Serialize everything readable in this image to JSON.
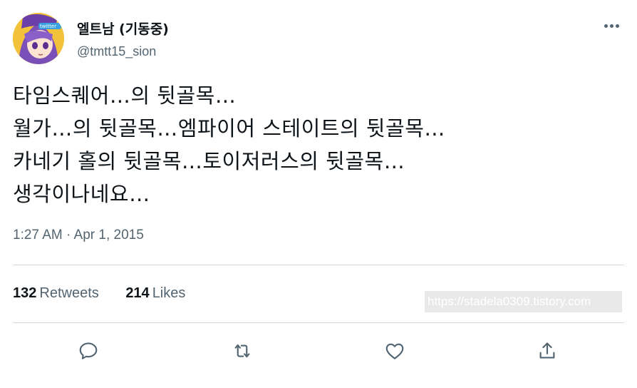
{
  "user": {
    "display_name": "엘트남 (기동중)",
    "handle": "@tmtt15_sion",
    "avatar_icon": "avatar-anime-character-icon",
    "avatar_badge_text": "twitter"
  },
  "tweet": {
    "lines": [
      "타임스퀘어…의 뒷골목…",
      "월가…의 뒷골목…엠파이어 스테이트의 뒷골목…",
      "카네기 홀의 뒷골목…토이저러스의 뒷골목…",
      "생각이나네요…"
    ],
    "timestamp": "1:27 AM · Apr 1, 2015"
  },
  "stats": {
    "retweets_count": "132",
    "retweets_label": "Retweets",
    "likes_count": "214",
    "likes_label": "Likes"
  },
  "watermark": "https://stadela0309.tistory.com",
  "actions": {
    "reply_icon": "reply-icon",
    "retweet_icon": "retweet-icon",
    "like_icon": "like-icon",
    "share_icon": "share-icon"
  },
  "colors": {
    "text_primary": "#0f1419",
    "text_secondary": "#536471",
    "divider": "#cfd9de",
    "avatar_bg": "#f2c23a"
  }
}
